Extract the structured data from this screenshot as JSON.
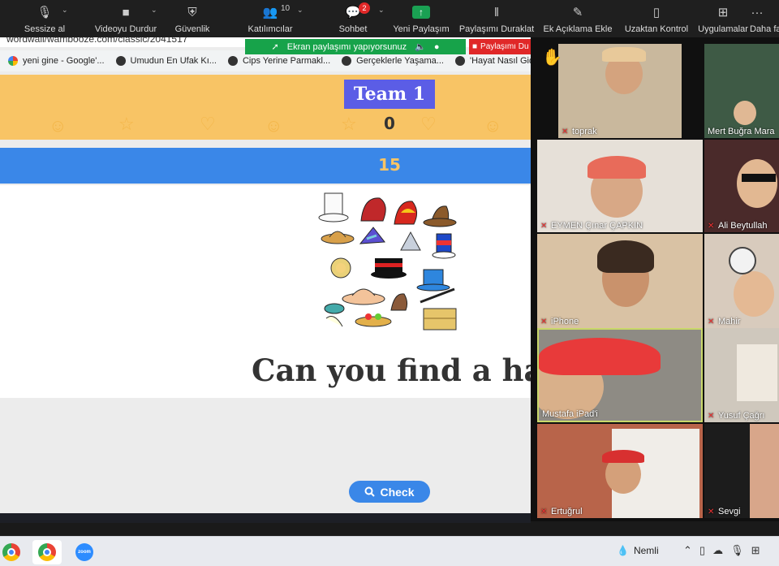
{
  "toolbar": {
    "mute": "Sessize al",
    "video": "Videoyu Durdur",
    "security": "Güvenlik",
    "participants": "Katılımcılar",
    "participants_count": "10",
    "chat": "Sohbet",
    "chat_badge": "2",
    "new_share": "Yeni Paylaşım",
    "pause_share": "Paylaşımı Duraklat",
    "annotate": "Ek Açıklama Ekle",
    "remote_control": "Uzaktan Kontrol",
    "apps": "Uygulamalar",
    "more": "Daha fa"
  },
  "share_bar": {
    "text": "Ekran paylaşımı yapıyorsunuz",
    "pause": "Paylaşımı Du"
  },
  "browser": {
    "address": "wordwall/wambooze.com/classic/2041517",
    "bookmarks": [
      {
        "label": "yeni gine - Google'..."
      },
      {
        "label": "Umudun En Ufak Kı..."
      },
      {
        "label": "Cips Yerine Parmakl..."
      },
      {
        "label": "Gerçeklerle Yaşama..."
      },
      {
        "label": "'Hayat Nasıl Gid"
      }
    ]
  },
  "game": {
    "team": "Team 1",
    "team_score": "0",
    "timer": "15",
    "question": "Can you find a hat?",
    "check": "Check"
  },
  "participants": [
    {
      "name": "toprak"
    },
    {
      "name": "Mert Buğra Mara"
    },
    {
      "name": "EYMEN Çınar ÇAPKIN"
    },
    {
      "name": "Ali Beytullah"
    },
    {
      "name": "iPhone"
    },
    {
      "name": "Mahir"
    },
    {
      "name": "Mustafa iPad'i"
    },
    {
      "name": "Yusuf Çağrı"
    },
    {
      "name": "Ertuğrul"
    },
    {
      "name": "Sevgi"
    }
  ],
  "taskbar": {
    "weather": "Nemli"
  },
  "colors": {
    "team_band": "#f8c465",
    "team_title": "#5b5de6",
    "timer_band": "#3a87e8",
    "share_green": "#17a34a",
    "active_speaker_border": "#c9d86a"
  }
}
